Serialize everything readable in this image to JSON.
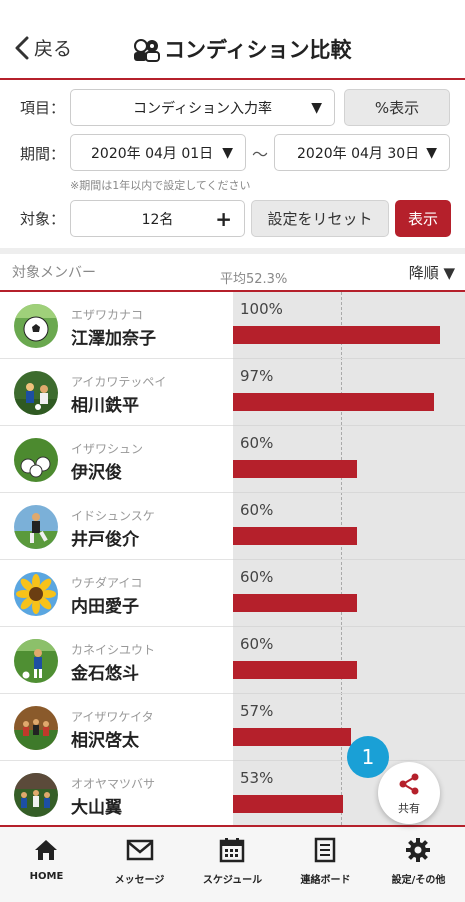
{
  "header": {
    "back_label": "戻る",
    "title": "コンディション比較"
  },
  "filters": {
    "item_label": "項目：",
    "item_value": "コンディション入力率",
    "percent_button": "%表示",
    "period_label": "期間：",
    "date_from": "2020年 04月 01日",
    "date_to": "2020年 04月 30日",
    "tilde": "〜",
    "note": "※期間は1年以内で設定してください",
    "target_label": "対象：",
    "target_value": "12名",
    "reset_button": "設定をリセット",
    "show_button": "表示"
  },
  "list_header": {
    "left": "対象メンバー",
    "average": "平均52.3%",
    "sort": "降順 ▼"
  },
  "members": [
    {
      "kana": "エザワカナコ",
      "name": "江澤加奈子",
      "percent_label": "100%",
      "value": 100,
      "avatar": "soccer-ball-grass"
    },
    {
      "kana": "アイカワテッペイ",
      "name": "相川鉄平",
      "percent_label": "97%",
      "value": 97,
      "avatar": "soccer-players-match"
    },
    {
      "kana": "イザワシュン",
      "name": "伊沢俊",
      "percent_label": "60%",
      "value": 60,
      "avatar": "soccer-balls-field"
    },
    {
      "kana": "イドシュンスケ",
      "name": "井戸俊介",
      "percent_label": "60%",
      "value": 60,
      "avatar": "soccer-player-kick"
    },
    {
      "kana": "ウチダアイコ",
      "name": "内田愛子",
      "percent_label": "60%",
      "value": 60,
      "avatar": "sunflower"
    },
    {
      "kana": "カネイシユウト",
      "name": "金石悠斗",
      "percent_label": "60%",
      "value": 60,
      "avatar": "soccer-player-field"
    },
    {
      "kana": "アイザワケイタ",
      "name": "相沢啓太",
      "percent_label": "57%",
      "value": 57,
      "avatar": "soccer-team"
    },
    {
      "kana": "オオヤマツバサ",
      "name": "大山翼",
      "percent_label": "53%",
      "value": 53,
      "avatar": "soccer-crowd"
    }
  ],
  "badge": "1",
  "share_label": "共有",
  "tabs": [
    {
      "label": "HOME",
      "icon": "home-icon"
    },
    {
      "label": "メッセージ",
      "icon": "mail-icon"
    },
    {
      "label": "スケジュール",
      "icon": "calendar-icon"
    },
    {
      "label": "連絡ボード",
      "icon": "board-icon"
    },
    {
      "label": "設定/その他",
      "icon": "gear-icon"
    }
  ],
  "colors": {
    "accent": "#b5202b",
    "badge": "#1aa0d6",
    "chart_bg": "#e6e6e6"
  }
}
